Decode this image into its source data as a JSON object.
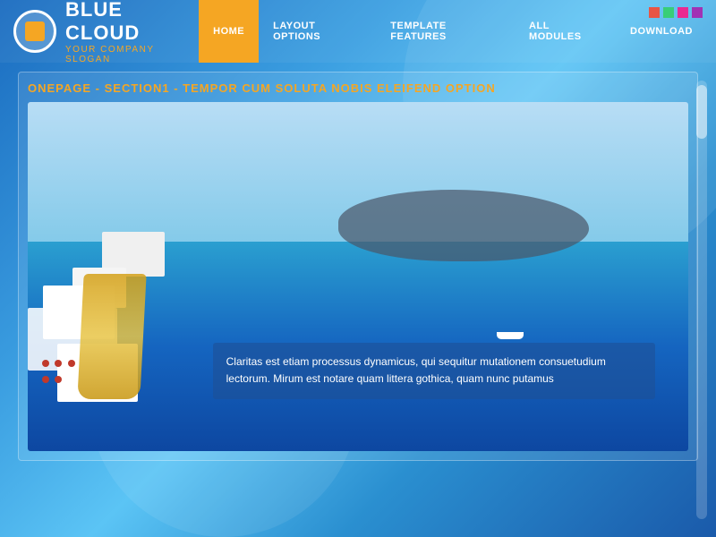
{
  "header": {
    "logo": {
      "title": "BLUE CLOUD",
      "slogan": "YOUR COMPANY SLOGAN"
    },
    "nav": {
      "items": [
        {
          "label": "HOME",
          "active": true
        },
        {
          "label": "LAYOUT OPTIONS",
          "active": false
        },
        {
          "label": "TEMPLATE FEATURES",
          "active": false
        },
        {
          "label": "ALL MODULES",
          "active": false
        },
        {
          "label": "DOWNLOAD",
          "active": false
        }
      ]
    },
    "color_squares": [
      {
        "color": "#e74c3c"
      },
      {
        "color": "#2ecc71"
      },
      {
        "color": "#e74c3c"
      },
      {
        "color": "#9b59b6"
      }
    ]
  },
  "main": {
    "section_title": "ONEPAGE - SECTION1 - TEMPOR CUM SOLUTA NOBIS ELEIFEND OPTION",
    "hero": {
      "overlay_text": "Claritas est etiam processus dynamicus, qui sequitur mutationem consuetudium lectorum. Mirum est notare quam littera gothica, quam nunc putamus"
    }
  }
}
